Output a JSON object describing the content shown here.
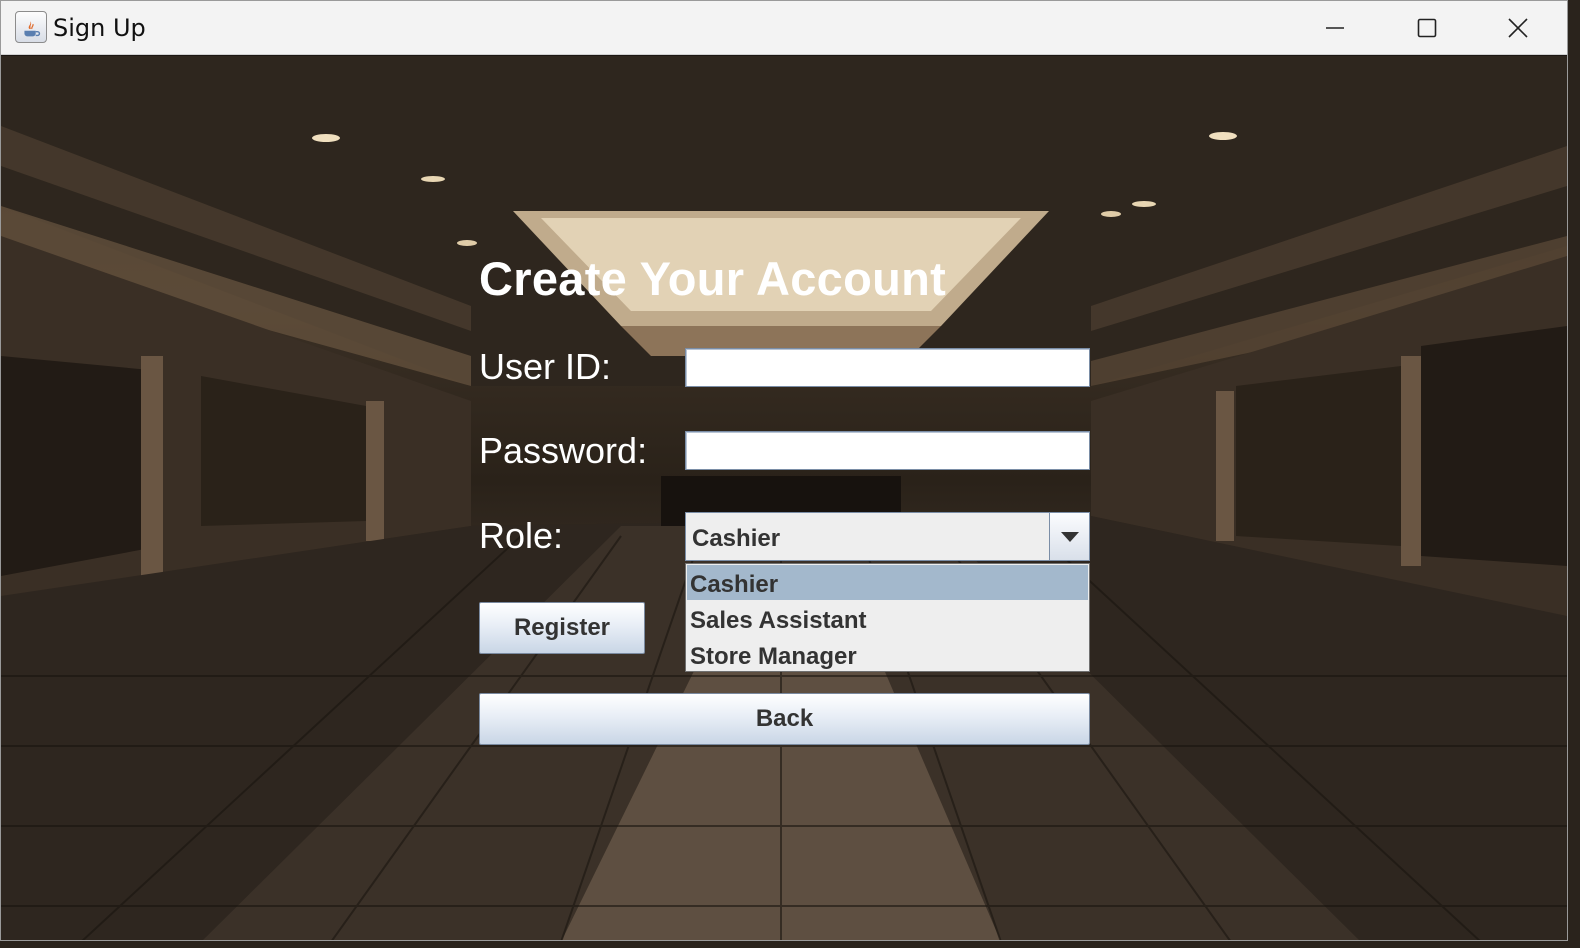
{
  "window": {
    "title": "Sign Up",
    "controls": {
      "minimize": "minimize-icon",
      "maximize": "maximize-icon",
      "close": "close-icon"
    }
  },
  "form": {
    "title": "Create Your Account",
    "user_id": {
      "label": "User ID:",
      "value": ""
    },
    "password": {
      "label": "Password:",
      "value": ""
    },
    "role": {
      "label": "Role:",
      "selected": "Cashier",
      "options": [
        "Cashier",
        "Sales Assistant",
        "Store Manager"
      ],
      "highlighted_index": 0
    },
    "register_label": "Register",
    "back_label": "Back"
  },
  "colors": {
    "titlebar": "#f3f3f3",
    "label_text": "#ffffff",
    "button_text": "#333333",
    "dropdown_highlight": "#a3b8cc"
  }
}
